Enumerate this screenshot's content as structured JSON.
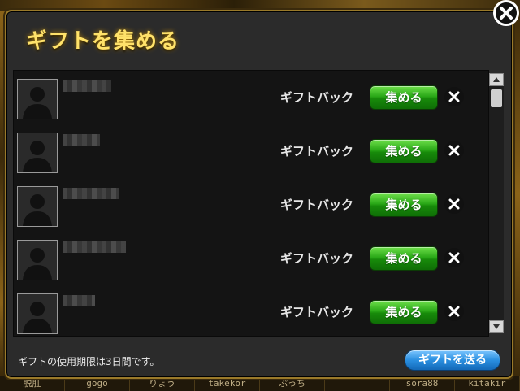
{
  "dialog": {
    "title": "ギフトを集める",
    "footer_note": "ギフトの使用期限は3日間です。",
    "send_button_label": "ギフトを送る"
  },
  "gifts": [
    {
      "label": "ギフトバック",
      "collect_label": "集める"
    },
    {
      "label": "ギフトバック",
      "collect_label": "集める"
    },
    {
      "label": "ギフトバック",
      "collect_label": "集める"
    },
    {
      "label": "ギフトバック",
      "collect_label": "集める"
    },
    {
      "label": "ギフトバック",
      "collect_label": "集める"
    }
  ],
  "background_bar": {
    "names": [
      "脱肛",
      "gogo",
      "りょう",
      "takekor",
      "ぷっち",
      "",
      "sora88",
      "kitakir"
    ]
  },
  "colors": {
    "title": "#ffe26a",
    "collect_button": "#2aa818",
    "send_button": "#2a8fe0",
    "panel": "#141414",
    "frame": "#9a7a2a"
  }
}
